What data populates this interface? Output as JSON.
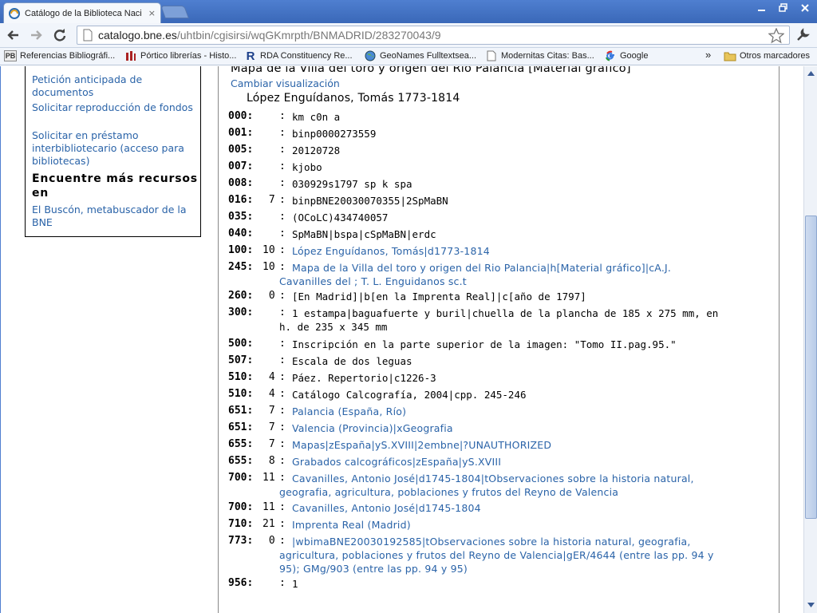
{
  "browser": {
    "tab_title": "Catálogo de la Biblioteca Naci",
    "tab_close": "×",
    "url_host": "catalogo.bne.es",
    "url_path": "/uhtbin/cgisirsi/wqGKmrpth/BNMADRID/283270043/9",
    "bookmarks": [
      {
        "icon": "pb-icon",
        "badge": "PB",
        "label": "Referencias Bibliográfi..."
      },
      {
        "icon": "portico-icon",
        "badge": "",
        "label": "Pórtico librerías - Histo..."
      },
      {
        "icon": "rda-icon",
        "badge": "R",
        "label": "RDA Constituency Re..."
      },
      {
        "icon": "globe-icon",
        "badge": "",
        "label": "GeoNames Fulltextsea..."
      },
      {
        "icon": "page-icon",
        "badge": "",
        "label": "Modernitas Citas: Bas..."
      },
      {
        "icon": "google-icon",
        "badge": "",
        "label": "Google"
      }
    ],
    "bookmarks_overflow": "»",
    "other_bookmarks": "Otros marcadores"
  },
  "sidebar": {
    "links": [
      "Petición anticipada de documentos",
      "Solicitar reproducción de fondos",
      "Solicitar en préstamo interbibliotecario (acceso para bibliotecas)"
    ],
    "heading": "Encuentre más recursos en",
    "buscon": "El Buscón, metabuscador de la BNE"
  },
  "record": {
    "title": "Mapa de la Villa del toro y origen del Rio Palancia [Material gráfico]",
    "change_view": "Cambiar visualización",
    "author": "López Enguídanos, Tomás 1773-1814",
    "fields": [
      {
        "tag": "000:",
        "ind": "",
        "value": "km c0n a",
        "link": false
      },
      {
        "tag": "001:",
        "ind": "",
        "value": "binp0000273559",
        "link": false
      },
      {
        "tag": "005:",
        "ind": "",
        "value": "20120728",
        "link": false
      },
      {
        "tag": "007:",
        "ind": "",
        "value": "kjobo",
        "link": false
      },
      {
        "tag": "008:",
        "ind": "",
        "value": "030929s1797 sp k spa",
        "link": false
      },
      {
        "tag": "016:",
        "ind": " 7",
        "value": "binpBNE20030070355|2SpMaBN",
        "link": false
      },
      {
        "tag": "035:",
        "ind": "",
        "value": "(OCoLC)434740057",
        "link": false
      },
      {
        "tag": "040:",
        "ind": "",
        "value": "SpMaBN|bspa|cSpMaBN|erdc",
        "link": false
      },
      {
        "tag": "100:",
        "ind": "10",
        "value": "López Enguídanos, Tomás|d1773-1814",
        "link": true
      },
      {
        "tag": "245:",
        "ind": "10",
        "value": "Mapa de la Villa del toro y origen del Rio Palancia|h[Material gráfico]|cA.J. Cavanilles del ; T. L. Enguidanos sc.t",
        "link": true
      },
      {
        "tag": "260:",
        "ind": " 0",
        "value": "[En Madrid]|b[en la Imprenta Real]|c[año de 1797]",
        "link": false
      },
      {
        "tag": "300:",
        "ind": "",
        "value": "1 estampa|baguafuerte y buril|chuella de la plancha de 185 x 275 mm, en h. de 235 x 345 mm",
        "link": false
      },
      {
        "tag": "500:",
        "ind": "",
        "value": "Inscripción en la parte superior de la imagen: \"Tomo II.pag.95.\"",
        "link": false
      },
      {
        "tag": "507:",
        "ind": "",
        "value": "Escala de dos leguas",
        "link": false
      },
      {
        "tag": "510:",
        "ind": " 4",
        "value": "Páez. Repertorio|c1226-3",
        "link": false
      },
      {
        "tag": "510:",
        "ind": " 4",
        "value": "Catálogo Calcografía, 2004|cpp. 245-246",
        "link": false
      },
      {
        "tag": "651:",
        "ind": " 7",
        "value": "Palancia (España, Río)",
        "link": true
      },
      {
        "tag": "651:",
        "ind": " 7",
        "value": "Valencia (Provincia)|xGeografia",
        "link": true
      },
      {
        "tag": "655:",
        "ind": " 7",
        "value": "Mapas|zEspaña|yS.XVIII|2embne|?UNAUTHORIZED",
        "link": true
      },
      {
        "tag": "655:",
        "ind": " 8",
        "value": "Grabados calcográficos|zEspaña|yS.XVIII",
        "link": true
      },
      {
        "tag": "700:",
        "ind": "11",
        "value": "Cavanilles, Antonio José|d1745-1804|tObservaciones sobre la historia natural, geografia, agricultura, poblaciones y frutos del Reyno de Valencia",
        "link": true
      },
      {
        "tag": "700:",
        "ind": "11",
        "value": "Cavanilles, Antonio José|d1745-1804",
        "link": true
      },
      {
        "tag": "710:",
        "ind": "21",
        "value": "Imprenta Real (Madrid)",
        "link": true
      },
      {
        "tag": "773:",
        "ind": " 0",
        "value": "|wbimaBNE20030192585|tObservaciones sobre la historia natural, geografia, agricultura, poblaciones y frutos del Reyno de Valencia|gER/4644 (entre las pp. 94 y 95); GMg/903 (entre las pp. 94 y 95)",
        "link": true
      },
      {
        "tag": "956:",
        "ind": "",
        "value": "1",
        "link": false
      }
    ]
  },
  "colors": {
    "link": "#2a63a8",
    "chrome": "#4f7fd0"
  }
}
